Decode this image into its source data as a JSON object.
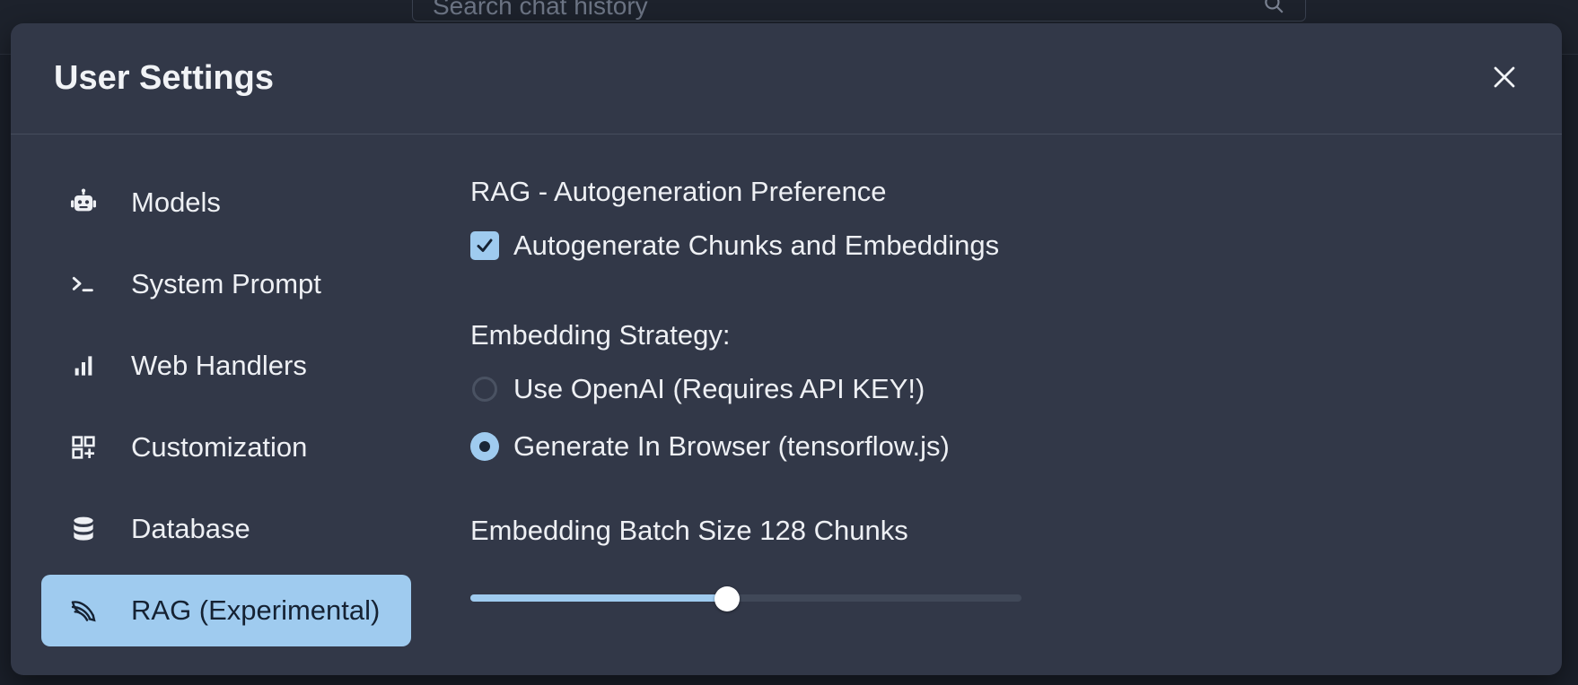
{
  "background": {
    "search_placeholder": "Search chat history",
    "search_icon": "search-icon"
  },
  "modal": {
    "title": "User Settings",
    "close_icon": "close-icon"
  },
  "sidebar": {
    "items": [
      {
        "label": "Models",
        "icon": "robot-icon",
        "active": false
      },
      {
        "label": "System Prompt",
        "icon": "terminal-prompt-icon",
        "active": false
      },
      {
        "label": "Web Handlers",
        "icon": "bar-chart-icon",
        "active": false
      },
      {
        "label": "Customization",
        "icon": "grid-add-icon",
        "active": false
      },
      {
        "label": "Database",
        "icon": "database-icon",
        "active": false
      },
      {
        "label": "RAG (Experimental)",
        "icon": "feather-icon",
        "active": true
      }
    ]
  },
  "rag": {
    "autogen_heading": "RAG - Autogeneration Preference",
    "autogen_checkbox_label": "Autogenerate Chunks and Embeddings",
    "autogen_checked": true,
    "strategy_heading": "Embedding Strategy:",
    "strategy_options": [
      {
        "label": "Use OpenAI (Requires API KEY!)",
        "selected": false
      },
      {
        "label": "Generate In Browser (tensorflow.js)",
        "selected": true
      }
    ],
    "batch_heading": "Embedding Batch Size 128 Chunks",
    "batch_slider_fraction": 0.465
  },
  "colors": {
    "accent": "#9fcbef",
    "modal_bg": "#323848",
    "page_bg": "#1a1f29"
  }
}
